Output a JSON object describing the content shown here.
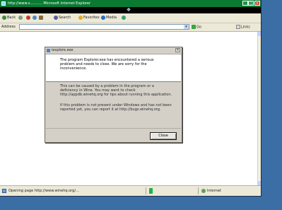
{
  "window": {
    "title": "http://www.s...........  Microsoft Internet Explorer",
    "buttons": {
      "minimize": "_",
      "maximize": "□",
      "close": "×"
    }
  },
  "toolbar": {
    "back_label": "Back",
    "search_label": "Search",
    "favorites_label": "Favorites",
    "media_label": "Media"
  },
  "addressbar": {
    "label": "Address",
    "url_value": "",
    "go_label": "Go",
    "links_label": "Links"
  },
  "dialog": {
    "title": "iexplore.exe",
    "close_glyph": "×",
    "header_text": "The program Explorer.exe has encountered a serious problem and needs to close. We are sorry for the inconvenience.",
    "para1": "This can be caused by a problem in the program or a deficiency in Wine. You may want to check http://appdb.winehq.org for tips about running this application.",
    "para2": "If this problem is not present under Windows and has not been reported yet, you can report it at http://bugs.winehq.org.",
    "close_button": "Close"
  },
  "statusbar": {
    "text": "Opening page http://www.winehq.org/...",
    "zone": "Internet"
  },
  "colors": {
    "desktop": "#3a6ea5",
    "titlebar": "#0a7a33",
    "progress": "#1eb34a"
  },
  "icons": {
    "back": "back-arrow-icon",
    "forward": "forward-arrow-icon",
    "stop": "stop-icon",
    "refresh": "refresh-icon",
    "home": "home-icon",
    "search": "search-icon",
    "favorites": "star-icon",
    "media": "media-icon",
    "history": "history-icon",
    "throbber": "windows-logo-icon"
  }
}
